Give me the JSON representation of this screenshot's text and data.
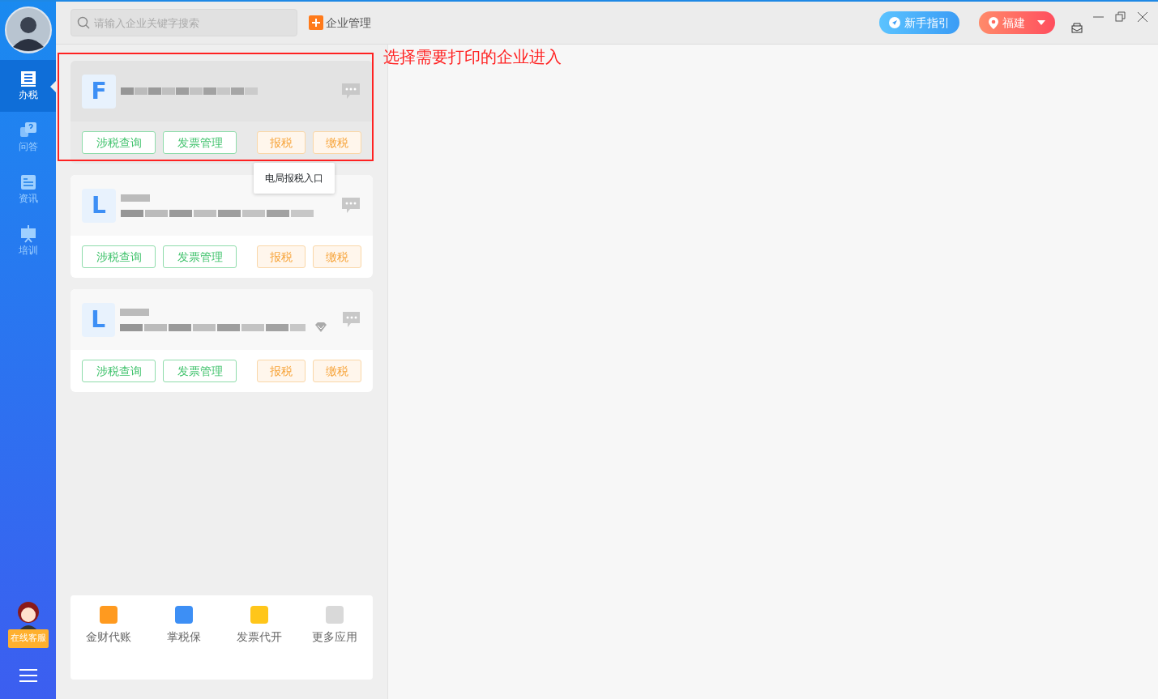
{
  "sidebar": {
    "items": [
      {
        "label": "办税",
        "kind": "tax",
        "selected": true
      },
      {
        "label": "问答",
        "kind": "qa",
        "selected": false
      },
      {
        "label": "资讯",
        "kind": "news",
        "selected": false
      },
      {
        "label": "培训",
        "kind": "training",
        "selected": false
      }
    ],
    "service_label": "在线客服"
  },
  "topbar": {
    "search": {
      "placeholder": "请输入企业关键字搜索"
    },
    "manage_label": "企业管理",
    "guide_label": "新手指引",
    "region_label": "福建"
  },
  "companies": [
    {
      "letter": "F",
      "hovered": true,
      "vip": false,
      "buttons": [
        {
          "label": "涉税查询",
          "kind": "green"
        },
        {
          "label": "发票管理",
          "kind": "green"
        },
        {
          "label": "报税",
          "kind": "orange"
        },
        {
          "label": "缴税",
          "kind": "orange"
        }
      ]
    },
    {
      "letter": "L",
      "hovered": false,
      "vip": false,
      "buttons": [
        {
          "label": "涉税查询",
          "kind": "green"
        },
        {
          "label": "发票管理",
          "kind": "green"
        },
        {
          "label": "报税",
          "kind": "orange"
        },
        {
          "label": "缴税",
          "kind": "orange"
        }
      ]
    },
    {
      "letter": "L",
      "hovered": false,
      "vip": true,
      "buttons": [
        {
          "label": "涉税查询",
          "kind": "green"
        },
        {
          "label": "发票管理",
          "kind": "green"
        },
        {
          "label": "报税",
          "kind": "orange"
        },
        {
          "label": "缴税",
          "kind": "orange"
        }
      ]
    }
  ],
  "tooltip": "电局报税入口",
  "annotation": "选择需要打印的企业进入",
  "apps": [
    {
      "label": "金财代账",
      "color": "#ff9a1f"
    },
    {
      "label": "掌税保",
      "color": "#3d8ff5"
    },
    {
      "label": "发票代开",
      "color": "#ffc61a"
    },
    {
      "label": "更多应用",
      "color": "#d9d9d9"
    }
  ]
}
